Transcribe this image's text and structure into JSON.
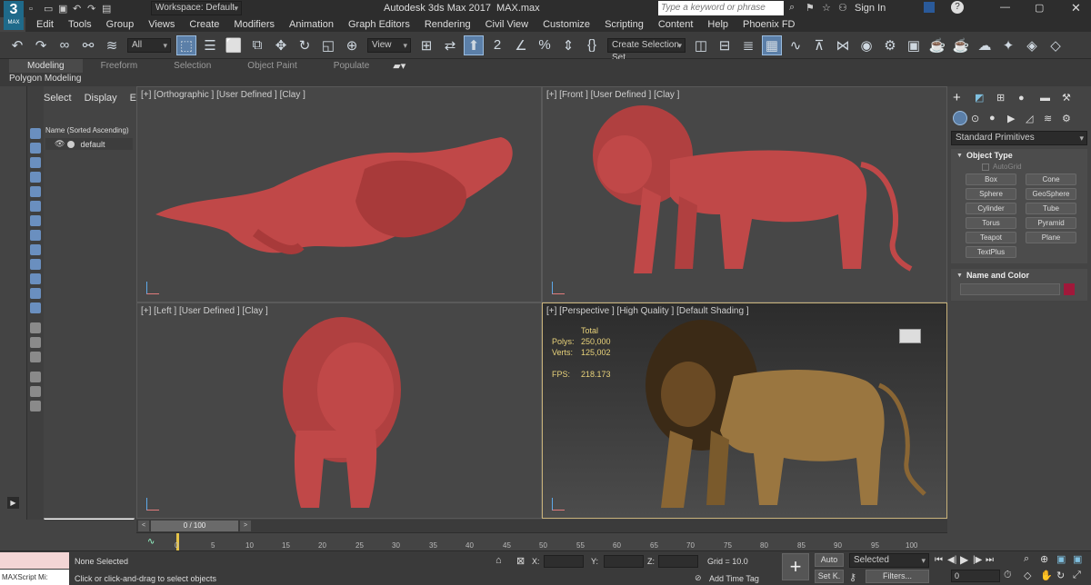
{
  "titlebar": {
    "logo": "3",
    "logo_sub": "MAX",
    "workspace": "Workspace: Default",
    "app_title": "Autodesk 3ds Max 2017",
    "file_name": "MAX.max",
    "search_placeholder": "Type a keyword or phrase",
    "sign_in": "Sign In"
  },
  "menu": [
    "Edit",
    "Tools",
    "Group",
    "Views",
    "Create",
    "Modifiers",
    "Animation",
    "Graph Editors",
    "Rendering",
    "Civil View",
    "Customize",
    "Scripting",
    "Content",
    "Help",
    "Phoenix FD"
  ],
  "toolbar": {
    "selection_filter": "All",
    "ref_coord": "View",
    "named_selection": "Create Selection Set"
  },
  "ribbon": {
    "tabs": [
      "Modeling",
      "Freeform",
      "Selection",
      "Object Paint",
      "Populate"
    ],
    "active": "Modeling",
    "sub_label": "Polygon Modeling"
  },
  "explorer": {
    "tabs": [
      "Select",
      "Display",
      "Edit"
    ],
    "header": "Name (Sorted Ascending)",
    "items": [
      "default"
    ]
  },
  "viewports": {
    "top_left": "[+] [Orthographic ] [User Defined ] [Clay ]",
    "top_right": "[+] [Front ] [User Defined ] [Clay ]",
    "bottom_left": "[+] [Left ] [User Defined ] [Clay ]",
    "bottom_right": "[+] [Perspective ] [High Quality ] [Default Shading ]",
    "stats": {
      "total_label": "Total",
      "polys_label": "Polys:",
      "polys_value": "250,000",
      "verts_label": "Verts:",
      "verts_value": "125,002",
      "fps_label": "FPS:",
      "fps_value": "218.173"
    }
  },
  "command_panel": {
    "category": "Standard Primitives",
    "object_type_title": "Object Type",
    "autogrid": "AutoGrid",
    "primitives": [
      "Box",
      "Cone",
      "Sphere",
      "GeoSphere",
      "Cylinder",
      "Tube",
      "Torus",
      "Pyramid",
      "Teapot",
      "Plane",
      "TextPlus"
    ],
    "name_color_title": "Name and Color",
    "color": "#a0183a"
  },
  "timeline": {
    "frame": "0 / 100",
    "ticks": [
      "0",
      "5",
      "10",
      "15",
      "20",
      "25",
      "30",
      "35",
      "40",
      "45",
      "50",
      "55",
      "60",
      "65",
      "70",
      "75",
      "80",
      "85",
      "90",
      "95",
      "100"
    ]
  },
  "status": {
    "maxscript": "MAXScript Mi:",
    "selection": "None Selected",
    "prompt": "Click or click-and-drag to select objects",
    "x_label": "X:",
    "y_label": "Y:",
    "z_label": "Z:",
    "grid": "Grid = 10.0",
    "add_time_tag": "Add Time Tag",
    "auto": "Auto",
    "set_key": "Set K.",
    "key_filter": "Selected",
    "filters": "Filters...",
    "frame_field": "0"
  },
  "colors": {
    "clay": "#c04848",
    "accent": "#5b7fa8",
    "perspective_border": "#c8b27a"
  }
}
